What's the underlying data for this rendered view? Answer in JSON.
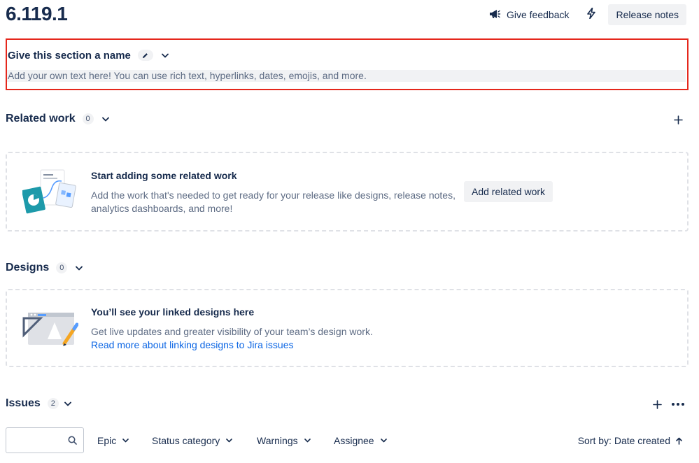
{
  "header": {
    "version": "6.119.1",
    "feedback_label": "Give feedback",
    "release_notes_label": "Release notes"
  },
  "custom_section": {
    "title": "Give this section a name",
    "placeholder_text": "Add your own text here! You can use rich text, hyperlinks, dates, emojis, and more."
  },
  "related_work": {
    "title": "Related work",
    "count": "0",
    "empty_title": "Start adding some related work",
    "empty_desc_line1": "Add the work that's needed to get ready for your release like designs, release notes,",
    "empty_desc_line2": "analytics dashboards, and more!",
    "add_button": "Add related work"
  },
  "designs": {
    "title": "Designs",
    "count": "0",
    "empty_title": "You’ll see your linked designs here",
    "empty_desc": "Get live updates and greater visibility of your team’s design work.",
    "link_text": "Read more about linking designs to Jira issues"
  },
  "issues": {
    "title": "Issues",
    "count": "2",
    "search_value": "",
    "filters": [
      "Epic",
      "Status category",
      "Warnings",
      "Assignee"
    ],
    "sort_label": "Sort by: Date created"
  },
  "icons": {
    "feedback": "megaphone-icon",
    "bolt": "lightning-bolt-icon",
    "edit": "pencil-icon",
    "chevron": "chevron-down-icon",
    "plus": "plus-icon",
    "more": "more-horizontal-icon",
    "search": "search-icon",
    "sort": "arrow-up-icon"
  },
  "colors": {
    "text": "#172b4d",
    "subtle_text": "#5e6c84",
    "link": "#0c66e4",
    "highlight_border": "#e5271c",
    "button_bg": "#f1f2f4",
    "dashed_border": "#dfe1e6"
  }
}
